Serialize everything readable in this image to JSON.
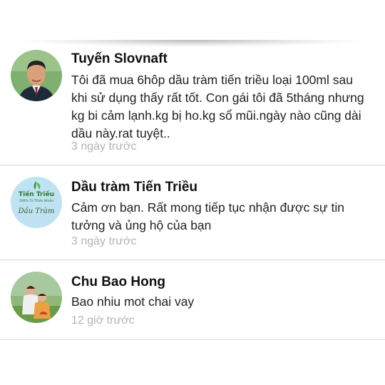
{
  "comments": [
    {
      "author": "Tuyến Slovnaft",
      "text": "Tôi đã mua 6hôp dầu tràm tiến triều loại 100ml sau khi sử dụng thấy rất tốt. Con gái tôi đã 5tháng nhưng kg bi cảm lạnh.kg bị ho.kg sổ mũi.ngày nào cũng dài dầu này.rat tuyệt..",
      "time": "3 ngày trước",
      "avatar_icon": "user-photo-icon"
    },
    {
      "author": "Dầu tràm Tiến Triều",
      "text": "Cảm ơn bạn. Rất mong tiếp tục nhận được sự tin tưởng và ủng hộ của bạn",
      "time": "3 ngày trước",
      "avatar_icon": "brand-logo-icon",
      "logo": {
        "line1": "Tiến Triều",
        "line2": "100% Từ Thiên Nhiên",
        "line3": "Dầu Tràm"
      }
    },
    {
      "author": "Chu Bao Hong",
      "text": "Bao nhiu mot chai vay",
      "time": "12 giờ trước",
      "avatar_icon": "user-photo-icon"
    }
  ],
  "colors": {
    "name": "#111111",
    "text": "#222222",
    "time": "#b3b3b3",
    "divider": "#dcdcdc"
  }
}
